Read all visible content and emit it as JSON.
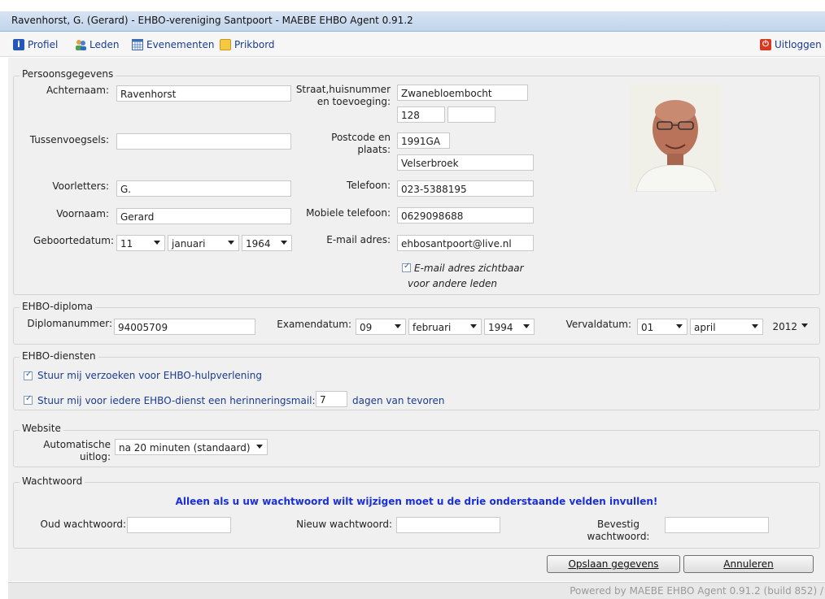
{
  "window": {
    "title": "Ravenhorst, G. (Gerard) - EHBO-vereniging Santpoort - MAEBE EHBO Agent 0.91.2"
  },
  "toolbar": {
    "items": [
      {
        "label": "Profiel",
        "icon": "info-icon"
      },
      {
        "label": "Leden",
        "icon": "users-icon"
      },
      {
        "label": "Evenementen",
        "icon": "calendar-icon"
      },
      {
        "label": "Prikbord",
        "icon": "note-icon"
      }
    ],
    "logout": {
      "label": "Uitloggen",
      "icon": "power-icon"
    }
  },
  "personal": {
    "legend": "Persoonsgegevens",
    "achternaam_label": "Achternaam:",
    "achternaam": "Ravenhorst",
    "tussenvoegsels_label": "Tussenvoegsels:",
    "tussenvoegsels": "",
    "voorletters_label": "Voorletters:",
    "voorletters": "G.",
    "voornaam_label": "Voornaam:",
    "voornaam": "Gerard",
    "geboortedatum_label": "Geboortedatum:",
    "geboorte_dag": "11",
    "geboorte_maand": "januari",
    "geboorte_jaar": "1964",
    "straat_label_1": "Straat,huisnummer",
    "straat_label_2": "en toevoeging:",
    "straat": "Zwanebloembocht",
    "huisnummer": "128",
    "toevoeging": "",
    "postcode_label_1": "Postcode en",
    "postcode_label_2": "plaats:",
    "postcode": "1991GA",
    "plaats": "Velserbroek",
    "telefoon_label": "Telefoon:",
    "telefoon": "023-5388195",
    "mobiel_label": "Mobiele telefoon:",
    "mobiel": "0629098688",
    "email_label": "E-mail adres:",
    "email": "ehbosantpoort@live.nl",
    "email_visible_label_1": "E-mail adres zichtbaar",
    "email_visible_label_2": "voor andere leden",
    "email_visible": true
  },
  "diploma": {
    "legend": "EHBO-diploma",
    "nummer_label": "Diplomanummer:",
    "nummer": "94005709",
    "examen_label": "Examendatum:",
    "examen_dag": "09",
    "examen_maand": "februari",
    "examen_jaar": "1994",
    "verval_label": "Vervaldatum:",
    "verval_dag": "01",
    "verval_maand": "april",
    "verval_jaar": "2012"
  },
  "diensten": {
    "legend": "EHBO-diensten",
    "verzoeken_label": "Stuur mij verzoeken voor EHBO-hulpverlening",
    "verzoeken": true,
    "herinnering_label": "Stuur mij voor iedere EHBO-dienst een herinneringsmail:",
    "herinnering": true,
    "dagen": "7",
    "dagen_label": "dagen van tevoren"
  },
  "website": {
    "legend": "Website",
    "uitlog_label_1": "Automatische",
    "uitlog_label_2": "uitlog:",
    "uitlog": "na 20 minuten (standaard)"
  },
  "password": {
    "legend": "Wachtwoord",
    "notice": "Alleen als u uw wachtwoord wilt wijzigen moet u de drie onderstaande velden invullen!",
    "oud_label": "Oud wachtwoord:",
    "nieuw_label": "Nieuw wachtwoord:",
    "bevestig_label_1": "Bevestig",
    "bevestig_label_2": "wachtwoord:"
  },
  "buttons": {
    "save": "Opslaan gegevens",
    "cancel": "Annuleren"
  },
  "status": {
    "text": "Powered by MAEBE EHBO Agent 0.91.2 (build 852) /"
  },
  "colors": {
    "link": "#1a3c8e",
    "notice": "#1a2fd6",
    "logout": "#d9381e"
  }
}
